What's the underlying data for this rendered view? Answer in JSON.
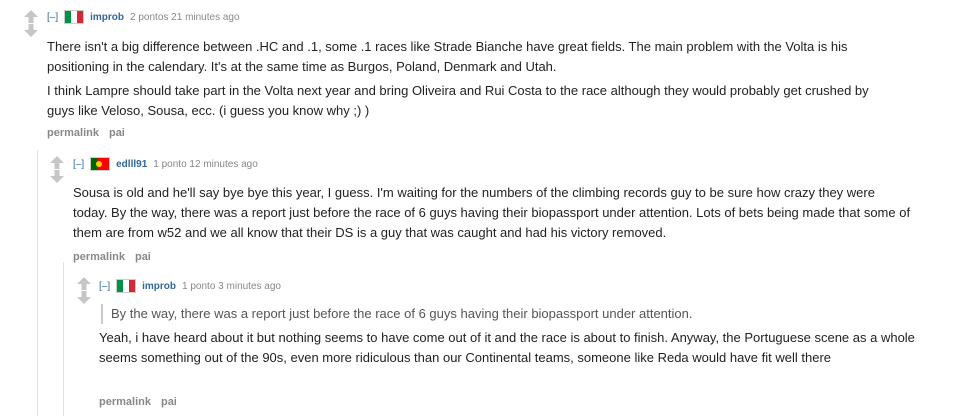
{
  "comments": [
    {
      "collapse": "[–]",
      "author": "improb",
      "score": "2 pontos",
      "time": "21 minutes ago",
      "paragraphs": [
        "There isn't a big difference between .HC and .1, some .1 races like Strade Bianche have great fields. The main problem with the Volta is his positioning in the calendary. It's at the same time as Burgos, Poland, Denmark and Utah.",
        "I think Lampre should take part in the Volta next year and bring Oliveira and Rui Costa to the race although they would probably get crushed by guys like Veloso, Sousa, ecc. (i guess you know why ;) )"
      ],
      "buttons": [
        "permalink",
        "pai"
      ]
    },
    {
      "collapse": "[–]",
      "author": "edlll91",
      "score": "1 ponto",
      "time": "12 minutes ago",
      "paragraphs": [
        "Sousa is old and he'll say bye bye this year, I guess. I'm waiting for the numbers of the climbing records guy to be sure how crazy they were today. By the way, there was a report just before the race of 6 guys having their biopassport under attention. Lots of bets being made that some of them are from w52 and we all know that their DS is a guy that was caught and had his victory removed."
      ],
      "buttons": [
        "permalink",
        "pai"
      ]
    },
    {
      "collapse": "[–]",
      "author": "improb",
      "score": "1 ponto",
      "time": "3 minutes ago",
      "quote": "By the way, there was a report just before the race of 6 guys having their biopassport under attention.",
      "paragraphs": [
        "Yeah, i have heard about it but nothing seems to have come out of it and the race is about to finish. Anyway, the Portuguese scene as a whole seems something out of the 90s, even more ridiculous than our Continental teams, someone like Reda would have fit well there"
      ],
      "buttons": [
        "permalink",
        "pai"
      ]
    }
  ],
  "flags": {
    "italy": [
      "#009246",
      "#ffffff",
      "#ce2b37"
    ],
    "portugal": [
      "#006600",
      "#ff0000"
    ]
  },
  "colors": {
    "link": "#336699",
    "meta": "#888888",
    "text": "#222222"
  }
}
